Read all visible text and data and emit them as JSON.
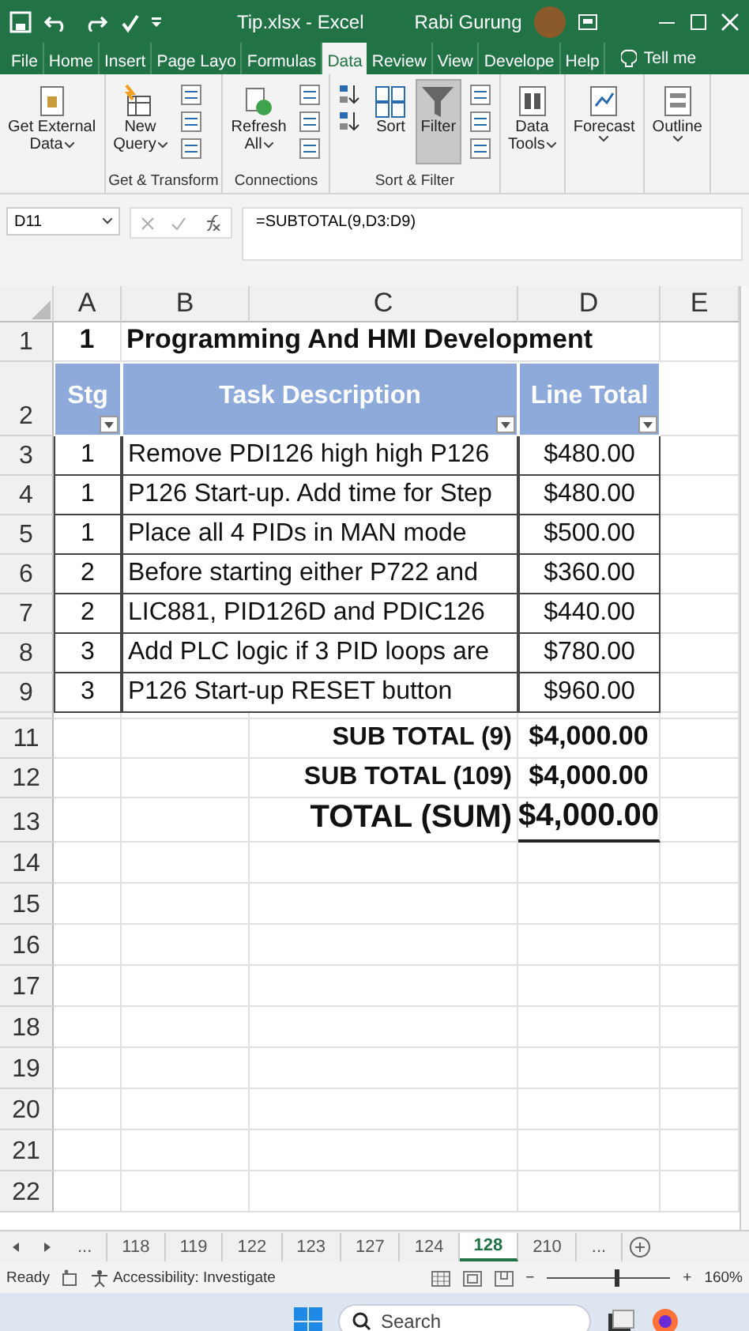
{
  "window": {
    "title": "Tip.xlsx  -  Excel",
    "user": "Rabi Gurung"
  },
  "ribbon_tabs": [
    {
      "label": "File",
      "selected": false
    },
    {
      "label": "Home",
      "selected": false
    },
    {
      "label": "Insert",
      "selected": false
    },
    {
      "label": "Page Layo",
      "selected": false
    },
    {
      "label": "Formulas",
      "selected": false
    },
    {
      "label": "Data",
      "selected": true
    },
    {
      "label": "Review",
      "selected": false
    },
    {
      "label": "View",
      "selected": false
    },
    {
      "label": "Develope",
      "selected": false
    },
    {
      "label": "Help",
      "selected": false
    }
  ],
  "tell_me": "Tell me",
  "ribbon_groups": [
    {
      "buttons": [
        {
          "kind": "large",
          "lines": [
            "Get External",
            "Data"
          ],
          "dropdown": true,
          "on": false
        }
      ]
    },
    {
      "label": "Get & Transform",
      "buttons": [
        {
          "kind": "large",
          "lines": [
            "New",
            "Query"
          ],
          "dropdown": true,
          "on": false
        },
        {
          "kind": "stack"
        }
      ]
    },
    {
      "label": "Connections",
      "buttons": [
        {
          "kind": "large",
          "lines": [
            "Refresh",
            "All"
          ],
          "dropdown": true,
          "on": false
        },
        {
          "kind": "stack"
        }
      ]
    },
    {
      "label": "Sort & Filter",
      "buttons": [
        {
          "kind": "sort-stack"
        },
        {
          "kind": "large",
          "lines": [
            "Sort"
          ],
          "dropdown": false,
          "on": false
        },
        {
          "kind": "large",
          "lines": [
            "Filter"
          ],
          "dropdown": false,
          "on": true
        },
        {
          "kind": "stack"
        }
      ]
    },
    {
      "buttons": [
        {
          "kind": "large",
          "lines": [
            "Data",
            "Tools"
          ],
          "dropdown": true,
          "on": false
        }
      ]
    },
    {
      "buttons": [
        {
          "kind": "large",
          "lines": [
            "Forecast"
          ],
          "dropdown": true,
          "on": false
        }
      ]
    },
    {
      "buttons": [
        {
          "kind": "large",
          "lines": [
            "Outline"
          ],
          "dropdown": true,
          "on": false
        }
      ]
    }
  ],
  "name_box": "D11",
  "formula": "=SUBTOTAL(9,D3:D9)",
  "columns": [
    "A",
    "B",
    "C",
    "D",
    "E"
  ],
  "rows": [
    {
      "kind": "title",
      "number": "1",
      "stg": "1",
      "text": "Programming And HMI Development"
    },
    {
      "kind": "header",
      "number": "2",
      "stg": "Stg",
      "text": "Task Description",
      "total": "Line Total"
    },
    {
      "kind": "item",
      "number": "3",
      "stg": "1",
      "text": "Remove PDI126 high high P126",
      "total": "$480.00"
    },
    {
      "kind": "item",
      "number": "4",
      "stg": "1",
      "text": "P126 Start-up. Add time for Step",
      "total": "$480.00"
    },
    {
      "kind": "item",
      "number": "5",
      "stg": "1",
      "text": "Place all 4 PIDs in MAN mode",
      "total": "$500.00"
    },
    {
      "kind": "item",
      "number": "6",
      "stg": "2",
      "text": "Before starting either P722 and",
      "total": "$360.00"
    },
    {
      "kind": "item",
      "number": "7",
      "stg": "2",
      "text": "LIC881, PID126D and PDIC126",
      "total": "$440.00"
    },
    {
      "kind": "item",
      "number": "8",
      "stg": "3",
      "text": "Add PLC logic if 3 PID loops are",
      "total": "$780.00"
    },
    {
      "kind": "item",
      "number": "9",
      "stg": "3",
      "text": "P126 Start-up RESET button",
      "total": "$960.00"
    },
    {
      "kind": "hidden"
    },
    {
      "kind": "subtotal",
      "number": "11",
      "text": "SUB TOTAL (9)",
      "total": "$4,000.00"
    },
    {
      "kind": "subtotal",
      "number": "12",
      "text": "SUB TOTAL (109)",
      "total": "$4,000.00"
    },
    {
      "kind": "total",
      "number": "13",
      "text": "TOTAL (SUM)",
      "total": "$4,000.00"
    },
    {
      "kind": "empty",
      "number": "14"
    },
    {
      "kind": "empty",
      "number": "15"
    },
    {
      "kind": "empty",
      "number": "16"
    },
    {
      "kind": "empty",
      "number": "17"
    },
    {
      "kind": "empty",
      "number": "18"
    },
    {
      "kind": "empty",
      "number": "19"
    },
    {
      "kind": "empty",
      "number": "20"
    },
    {
      "kind": "empty",
      "number": "21"
    },
    {
      "kind": "empty",
      "number": "22"
    }
  ],
  "sheet_tabs": [
    {
      "label": "...",
      "selected": false
    },
    {
      "label": "118",
      "selected": false
    },
    {
      "label": "119",
      "selected": false
    },
    {
      "label": "122",
      "selected": false
    },
    {
      "label": "123",
      "selected": false
    },
    {
      "label": "127",
      "selected": false
    },
    {
      "label": "124",
      "selected": false
    },
    {
      "label": "128",
      "selected": true
    },
    {
      "label": "210",
      "selected": false
    },
    {
      "label": "...",
      "selected": false
    }
  ],
  "status_bar": {
    "state": "Ready",
    "accessibility": "Accessibility: Investigate",
    "zoom": "160%",
    "zoom_out": "−",
    "zoom_in": "+",
    "zoom_slider": {
      "level": 0.55
    }
  },
  "taskbar": {
    "search": {
      "placeholder": "Search"
    }
  }
}
